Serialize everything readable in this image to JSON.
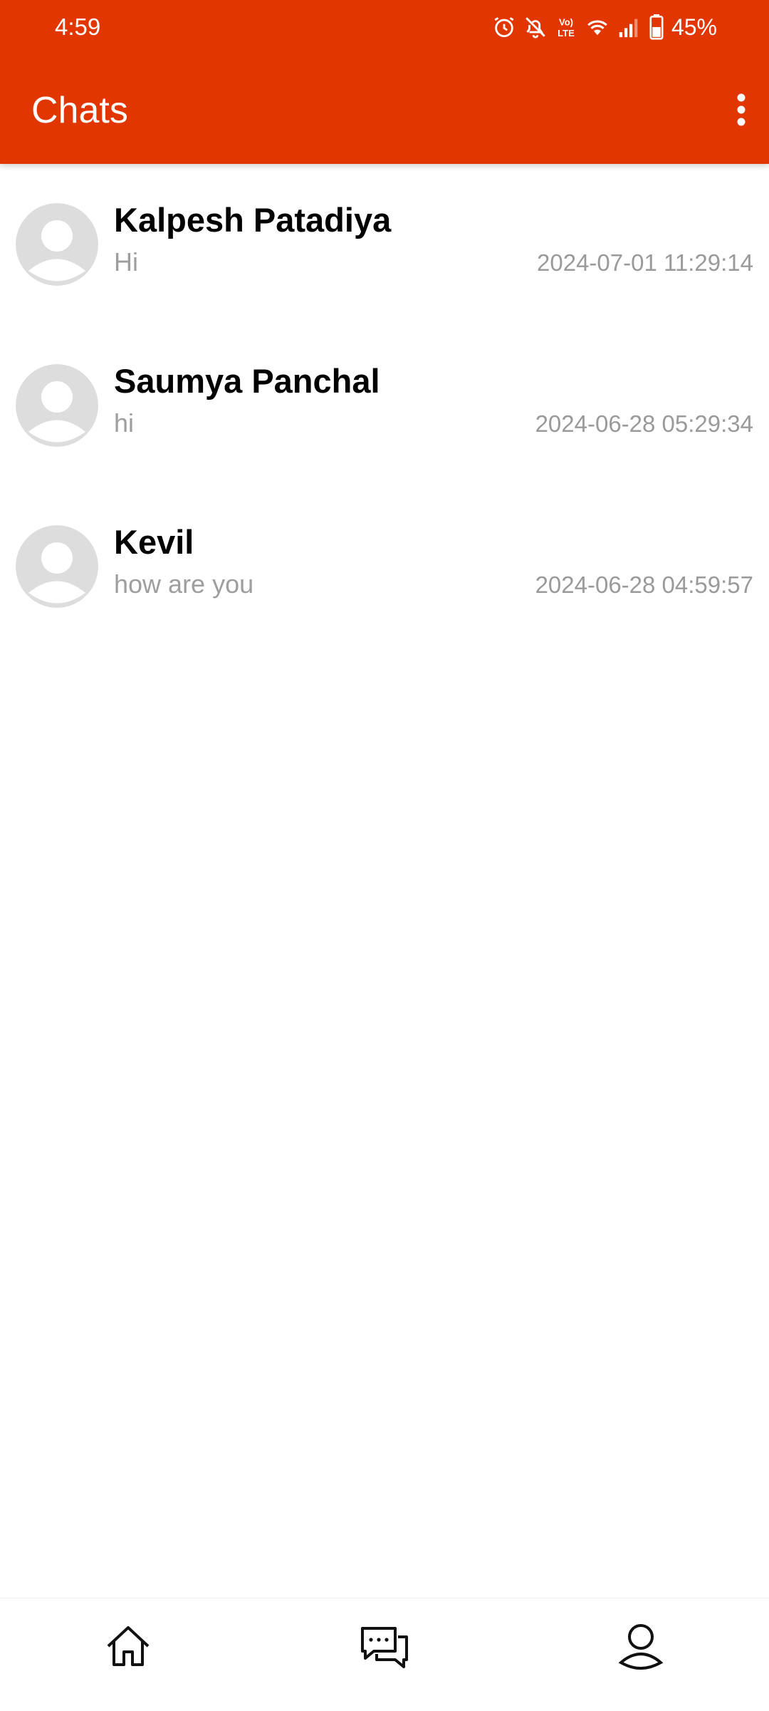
{
  "status_bar": {
    "time": "4:59",
    "battery_percent": "45%",
    "icons": [
      "alarm-icon",
      "notifications-off-icon",
      "volte-icon",
      "wifi-icon",
      "signal-icon",
      "battery-icon"
    ]
  },
  "header": {
    "title": "Chats",
    "menu_icon": "more-vert-icon"
  },
  "chats": [
    {
      "name": "Kalpesh Patadiya",
      "last_message": "Hi",
      "timestamp": "2024-07-01 11:29:14"
    },
    {
      "name": "Saumya Panchal",
      "last_message": "hi",
      "timestamp": "2024-06-28 05:29:34"
    },
    {
      "name": "Kevil",
      "last_message": "how are you",
      "timestamp": "2024-06-28 04:59:57"
    }
  ],
  "bottom_nav": {
    "items": [
      "home-icon",
      "chat-icon",
      "profile-icon"
    ]
  },
  "colors": {
    "accent": "#E23600",
    "name_text": "#000000",
    "secondary_text": "#9E9E9E",
    "avatar_bg": "#DDDDDD"
  }
}
